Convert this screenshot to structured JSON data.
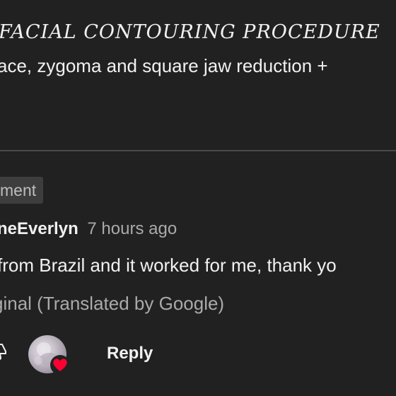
{
  "video": {
    "title_fragment": "FACIAL CONTOURING PROCEDURE",
    "description_fragment": "ace, zygoma and square jaw reduction +"
  },
  "comment_section": {
    "chip_label": "ment"
  },
  "comment": {
    "author": "neEverlyn",
    "timestamp": "7 hours ago",
    "text": "from Brazil and it worked for me, thank yo",
    "see_original_label": "ginal (Translated by Google)"
  },
  "actions": {
    "reply_label": "Reply",
    "dislike_icon": "thumbs-down-icon",
    "creator_heart_icon": "heart-icon",
    "heart_color": "#ff0033"
  }
}
